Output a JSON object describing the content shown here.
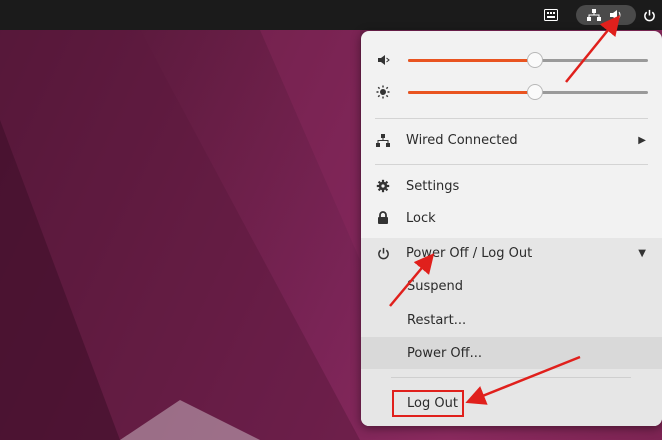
{
  "topbar": {
    "keyboard_icon": "keyboard-icon",
    "network_icon": "network-icon",
    "volume_icon": "speaker-icon",
    "power_icon": "power-icon"
  },
  "menu": {
    "volume": {
      "icon": "speaker-icon",
      "level": 0.53
    },
    "brightness": {
      "icon": "brightness-icon",
      "level": 0.53
    },
    "network": {
      "icon": "network-icon",
      "label": "Wired Connected",
      "trail": "▶"
    },
    "settings": {
      "icon": "gear-icon",
      "label": "Settings"
    },
    "lock": {
      "icon": "lock-icon",
      "label": "Lock"
    },
    "power": {
      "icon": "power-icon",
      "label": "Power Off / Log Out",
      "trail": "▼"
    },
    "submenu": {
      "suspend": "Suspend",
      "restart": "Restart...",
      "power_off": "Power Off...",
      "log_out": "Log Out"
    }
  },
  "colors": {
    "accent": "#e95420",
    "annotation": "#e0201c",
    "topbar": "#1b1b1b",
    "menu_bg": "#f2f2f2"
  }
}
